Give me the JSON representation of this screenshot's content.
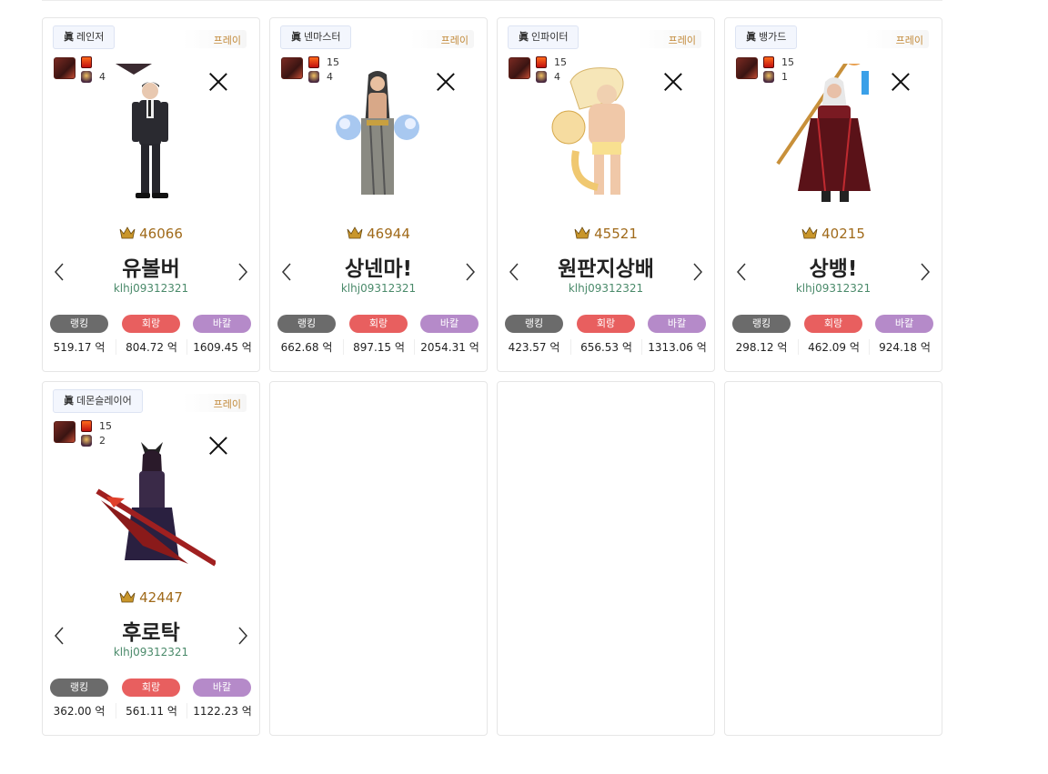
{
  "server_label": "프레이",
  "true_mark": "眞",
  "unit": "억",
  "stat_labels": {
    "rank": "랭킹",
    "hoerang": "회랑",
    "bakal": "바칼"
  },
  "cards": [
    {
      "job": "레인저",
      "num_top": "",
      "num_bottom": "4",
      "fame": "46066",
      "name": "유볼버",
      "adventure": "klhj09312321",
      "rank": "519.17",
      "hoerang": "804.72",
      "bakal": "1609.45"
    },
    {
      "job": "넨마스터",
      "num_top": "15",
      "num_bottom": "4",
      "fame": "46944",
      "name": "상넨마!",
      "adventure": "klhj09312321",
      "rank": "662.68",
      "hoerang": "897.15",
      "bakal": "2054.31"
    },
    {
      "job": "인파이터",
      "num_top": "15",
      "num_bottom": "4",
      "fame": "45521",
      "name": "원판지상배",
      "adventure": "klhj09312321",
      "rank": "423.57",
      "hoerang": "656.53",
      "bakal": "1313.06"
    },
    {
      "job": "뱅가드",
      "num_top": "15",
      "num_bottom": "1",
      "fame": "40215",
      "name": "상뱅!",
      "adventure": "klhj09312321",
      "rank": "298.12",
      "hoerang": "462.09",
      "bakal": "924.18"
    },
    {
      "job": "데몬슬레이어",
      "num_top": "15",
      "num_bottom": "2",
      "fame": "42447",
      "name": "후로탁",
      "adventure": "klhj09312321",
      "rank": "362.00",
      "hoerang": "561.11",
      "bakal": "1122.23"
    }
  ],
  "colors": {
    "rank": "#6b6b6b",
    "hoerang": "#e85f5f",
    "bakal": "#b58ac9",
    "fame": "#a06a1a",
    "adventure": "#4a8a6a",
    "server": "#c28a3a"
  }
}
